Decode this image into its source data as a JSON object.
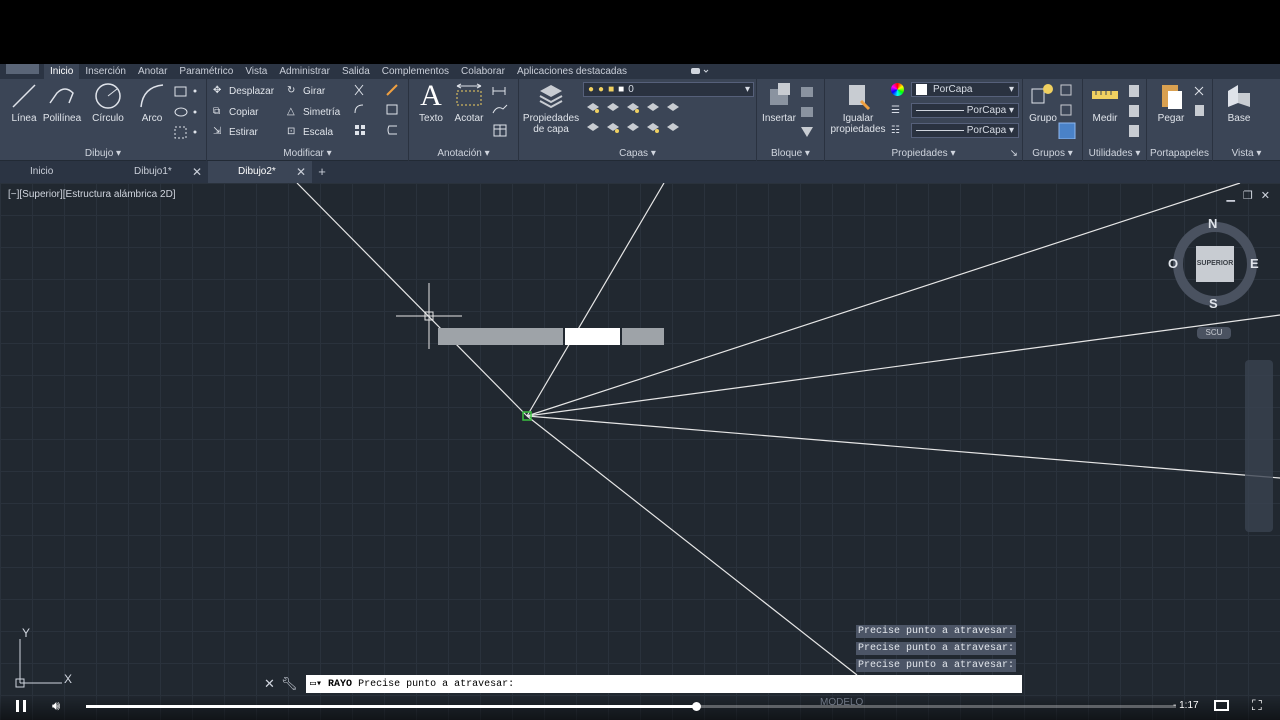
{
  "ribbon_tabs": [
    "Inicio",
    "Inserción",
    "Anotar",
    "Paramétrico",
    "Vista",
    "Administrar",
    "Salida",
    "Complementos",
    "Colaborar",
    "Aplicaciones destacadas"
  ],
  "panels": {
    "dibujo": {
      "title": "Dibujo",
      "linea": "Línea",
      "polilinea": "Polilínea",
      "circulo": "Círculo",
      "arco": "Arco"
    },
    "modificar": {
      "title": "Modificar",
      "desplazar": "Desplazar",
      "girar": "Girar",
      "copiar": "Copiar",
      "simetria": "Simetría",
      "estirar": "Estirar",
      "escala": "Escala"
    },
    "anotacion": {
      "title": "Anotación",
      "texto": "Texto",
      "acotar": "Acotar"
    },
    "capas": {
      "title": "Capas",
      "propiedades_capa_1": "Propiedades",
      "propiedades_capa_2": "de capa",
      "layer_value": "0"
    },
    "bloque": {
      "title": "Bloque",
      "insertar": "Insertar"
    },
    "propiedades": {
      "title": "Propiedades",
      "igualar_1": "Igualar",
      "igualar_2": "propiedades",
      "color": "PorCapa",
      "linetype": "PorCapa",
      "lineweight": "PorCapa"
    },
    "grupos": {
      "title": "Grupos",
      "grupo": "Grupo"
    },
    "utilidades": {
      "title": "Utilidades",
      "medir": "Medir"
    },
    "portapapeles": {
      "title": "Portapapeles",
      "pegar": "Pegar"
    },
    "vista": {
      "title": "Vista",
      "base": "Base"
    }
  },
  "doc_tabs": [
    {
      "label": "Inicio"
    },
    {
      "label": "Dibujo1*"
    },
    {
      "label": "Dibujo2*"
    }
  ],
  "viewport_label": "[−][Superior][Estructura alámbrica 2D]",
  "viewcube": {
    "face": "SUPERIOR",
    "n": "N",
    "s": "S",
    "e": "E",
    "o": "O",
    "scu": "SCU"
  },
  "command_history": [
    "Precise punto a atravesar:",
    "Precise punto a atravesar:",
    "Precise punto a atravesar:"
  ],
  "command_line": {
    "command": "RAYO",
    "prompt": "Precise punto a atravesar:"
  },
  "ucs": {
    "x": "X",
    "y": "Y"
  },
  "player": {
    "time": "1:17",
    "progress": 0.56,
    "status_model": "MODELO"
  },
  "colors": {
    "ribbon": "#3b4556",
    "canvas": "#212830",
    "ray": "#e6e6e6"
  }
}
